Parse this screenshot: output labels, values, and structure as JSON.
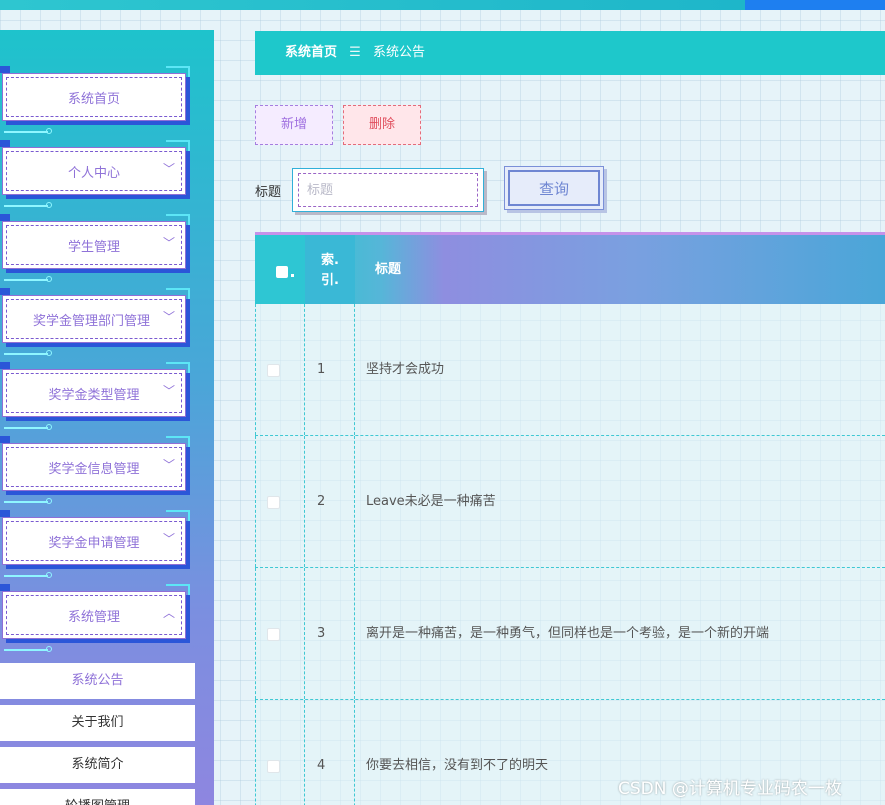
{
  "sidebar": {
    "items": [
      {
        "label": "系统首页",
        "chevron": ""
      },
      {
        "label": "个人中心",
        "chevron": "﹀"
      },
      {
        "label": "学生管理",
        "chevron": "﹀"
      },
      {
        "label": "奖学金管理部门管理",
        "chevron": "﹀"
      },
      {
        "label": "奖学金类型管理",
        "chevron": "﹀"
      },
      {
        "label": "奖学金信息管理",
        "chevron": "﹀"
      },
      {
        "label": "奖学金申请管理",
        "chevron": "﹀"
      },
      {
        "label": "系统管理",
        "chevron": "︿"
      }
    ],
    "sub_items": [
      {
        "label": "系统公告"
      },
      {
        "label": "关于我们"
      },
      {
        "label": "系统简介"
      },
      {
        "label": "轮播图管理"
      }
    ]
  },
  "breadcrumb": {
    "home": "系统首页",
    "separator": "☰",
    "current": "系统公告"
  },
  "toolbar": {
    "add_label": "新增",
    "delete_label": "删除"
  },
  "search": {
    "label": "标题",
    "placeholder": "标题",
    "value": "",
    "button_label": "查询"
  },
  "table": {
    "headers": {
      "index_line1": "索.",
      "index_line2": "引.",
      "title": "标题"
    },
    "rows": [
      {
        "index": "1",
        "title": "坚持才会成功"
      },
      {
        "index": "2",
        "title": "Leave未必是一种痛苦"
      },
      {
        "index": "3",
        "title": "离开是一种痛苦，是一种勇气，但同样也是一个考验，是一个新的开端"
      },
      {
        "index": "4",
        "title": "你要去相信，没有到不了的明天"
      }
    ]
  },
  "watermark": "CSDN @计算机专业码农一枚",
  "colors": {
    "accent_teal": "#1ec8cb",
    "accent_purple": "#8f72d8",
    "delete_red": "#e04d5c"
  }
}
